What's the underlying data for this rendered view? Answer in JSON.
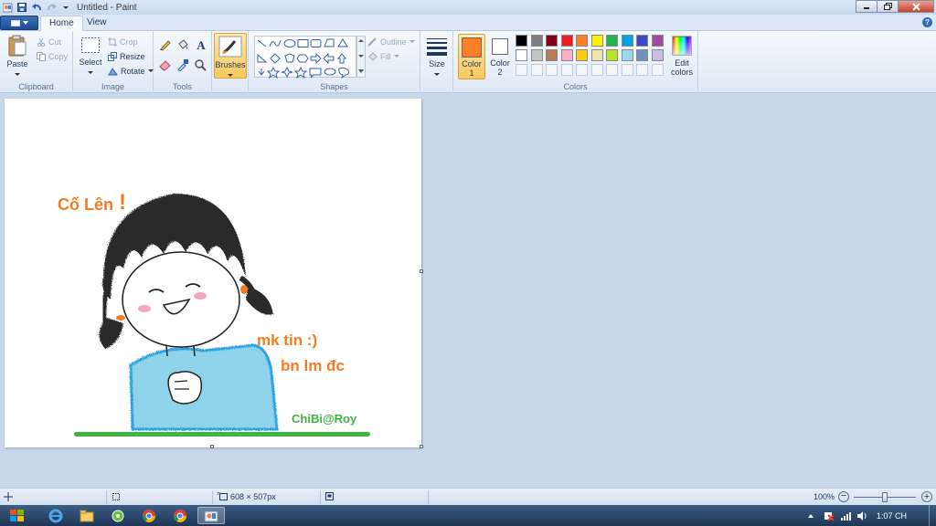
{
  "window": {
    "title": "Untitled - Paint"
  },
  "tabs": [
    {
      "label": "Home"
    },
    {
      "label": "View"
    }
  ],
  "clipboard": {
    "paste": "Paste",
    "cut": "Cut",
    "copy": "Copy",
    "group": "Clipboard"
  },
  "image": {
    "select": "Select",
    "crop": "Crop",
    "resize": "Resize",
    "rotate": "Rotate",
    "group": "Image"
  },
  "tools": {
    "group": "Tools"
  },
  "brushes": {
    "label": "Brushes"
  },
  "shapes": {
    "outline": "Outline",
    "fill": "Fill",
    "group": "Shapes"
  },
  "size": {
    "label": "Size"
  },
  "colors": {
    "color1": "Color",
    "color1_num": "1",
    "color2": "Color",
    "color2_num": "2",
    "edit_line1": "Edit",
    "edit_line2": "colors",
    "group": "Colors",
    "color1_value": "#ff7f27",
    "color2_value": "#ffffff",
    "row1": [
      "#000000",
      "#7f7f7f",
      "#880015",
      "#ed1c24",
      "#ff7f27",
      "#fff200",
      "#22b14c",
      "#00a2e8",
      "#3f48cc",
      "#a349a4"
    ],
    "row2": [
      "#ffffff",
      "#c3c3c3",
      "#b97a57",
      "#ffaec9",
      "#ffc90e",
      "#efe4b0",
      "#b5e61d",
      "#99d9ea",
      "#7092be",
      "#c8bfe7"
    ]
  },
  "drawing": {
    "text1": "Cố Lên",
    "text1_mark": "!",
    "text2": "mk tin :)",
    "text3": "bn lm đc",
    "signature": "ChiBi@Roy",
    "orange": "#f47c20",
    "green": "#3fb540"
  },
  "status": {
    "dimensions": "608 × 507px",
    "zoom": "100%"
  },
  "tray": {
    "time": "1:07 CH"
  }
}
